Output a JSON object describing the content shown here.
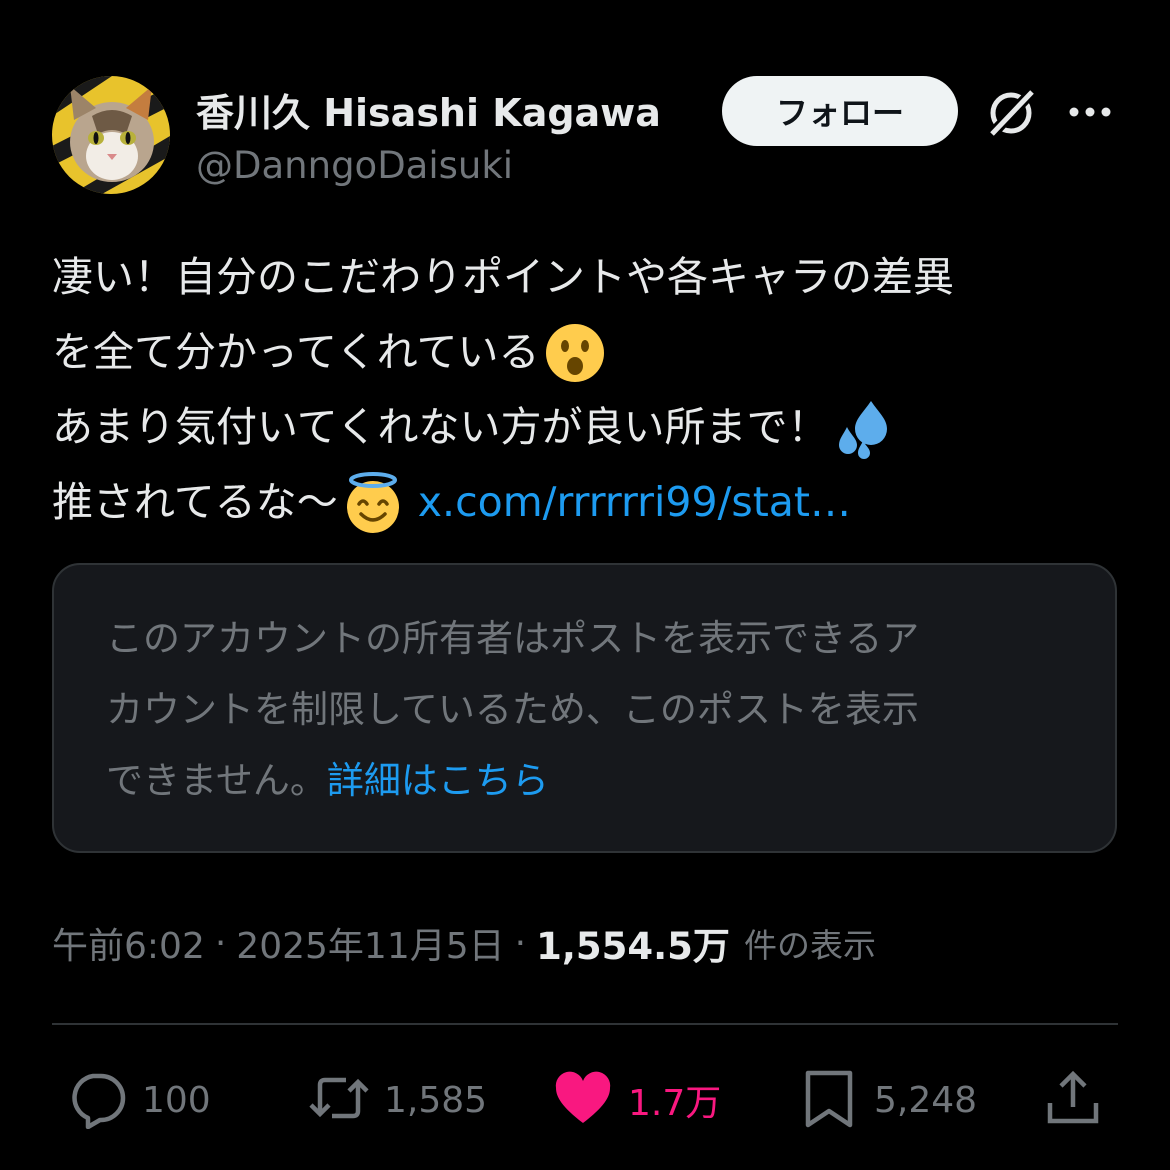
{
  "author": {
    "display_name": "香川久 Hisashi Kagawa",
    "handle": "@DanngoDaisuki"
  },
  "header": {
    "follow_label": "フォロー",
    "grok_icon": "grok-icon",
    "more_icon": "more-icon"
  },
  "post": {
    "line1": "凄い！自分のこだわりポイントや各キャラの差異",
    "line2": "を全て分かってくれている",
    "line3": "あまり気付いてくれない方が良い所まで！",
    "line4": "推されてるな〜",
    "link_text": "x.com/rrrrrri99/stat…",
    "emoji1": "face-with-open-mouth",
    "emoji2": "sweat-droplets",
    "emoji3": "smiling-face-with-halo"
  },
  "quoted_notice": {
    "line1": "このアカウントの所有者はポストを表示できるア",
    "line2": "カウントを制限しているため、このポストを表示",
    "line3": "できません。",
    "link": "詳細はこちら"
  },
  "meta": {
    "time": "午前6:02",
    "date": "2025年11月5日",
    "views": "1,554.5万",
    "views_label": "件の表示"
  },
  "actions": {
    "replies": "100",
    "reposts": "1,585",
    "likes": "1.7万",
    "bookmarks": "5,248"
  },
  "colors": {
    "background": "#000000",
    "text": "#e7e9ea",
    "muted": "#71767b",
    "link": "#1d9bf0",
    "like": "#f91880"
  }
}
